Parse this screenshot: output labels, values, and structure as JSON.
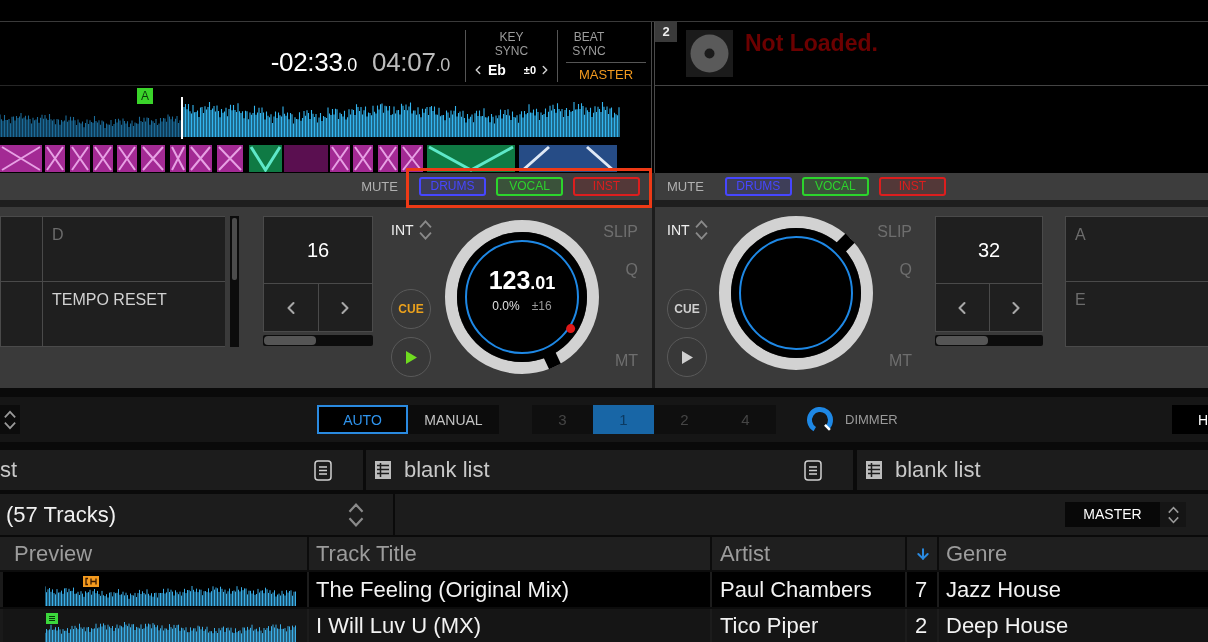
{
  "decks": [
    {
      "loaded": true,
      "remaining_time": {
        "value": "-02:33",
        "fraction": ".0"
      },
      "total_time": {
        "value": "04:07",
        "fraction": ".0"
      },
      "key_sync": {
        "label": "KEY SYNC",
        "key": "Eb",
        "offset": "±0"
      },
      "beat_sync": {
        "label": "BEAT SYNC",
        "master": "MASTER"
      },
      "memory_cue": "A",
      "mute": {
        "label": "MUTE",
        "highlighted": true,
        "buttons": [
          {
            "label": "DRUMS",
            "color": "#4646ff"
          },
          {
            "label": "VOCAL",
            "color": "#2cd42c"
          },
          {
            "label": "INST",
            "color": "#dc1e1e"
          }
        ]
      },
      "pads": [
        {
          "label": "D",
          "assigned": false
        },
        {
          "label": "TEMPO RESET",
          "assigned": true
        }
      ],
      "beat_loop": "16",
      "int_label": "INT",
      "cue": {
        "label": "CUE",
        "lit": true
      },
      "play": {
        "on": true
      },
      "jog": {
        "bpm": "123",
        "bpm_fraction": ".01",
        "pitch": "0.0%",
        "range": "±16",
        "cue_marker": true
      },
      "modes": [
        "SLIP",
        "Q",
        "MT"
      ]
    },
    {
      "loaded": false,
      "badge": "2",
      "status": "Not Loaded.",
      "mute": {
        "label": "MUTE",
        "buttons": [
          {
            "label": "DRUMS",
            "color": "#4646ff"
          },
          {
            "label": "VOCAL",
            "color": "#2cd42c"
          },
          {
            "label": "INST",
            "color": "#dc1e1e"
          }
        ]
      },
      "pads": [
        {
          "label": "A",
          "assigned": false
        },
        {
          "label": "E",
          "assigned": false
        }
      ],
      "beat_loop": "32",
      "int_label": "INT",
      "cue": {
        "label": "CUE",
        "lit": false
      },
      "play": {
        "on": false
      },
      "modes": [
        "SLIP",
        "Q",
        "MT"
      ]
    }
  ],
  "mixer_bar": {
    "sync_modes": [
      {
        "label": "AUTO",
        "selected": true
      },
      {
        "label": "MANUAL",
        "selected": false
      }
    ],
    "deck_order": [
      {
        "label": "3",
        "selected": false
      },
      {
        "label": "1",
        "selected": true
      },
      {
        "label": "2",
        "selected": false
      },
      {
        "label": "4",
        "selected": false
      }
    ],
    "dimmer": {
      "label": "DIMMER"
    },
    "right_button": "H"
  },
  "browser": {
    "panels": [
      {
        "title": "st"
      },
      {
        "title": "blank list"
      },
      {
        "title": "blank list"
      }
    ],
    "track_count": "(57 Tracks)",
    "master_select": "MASTER",
    "table": {
      "columns": [
        {
          "label": "Preview",
          "sorted": false
        },
        {
          "label": "Track Title",
          "sorted": false
        },
        {
          "label": "Artist",
          "sorted": false
        },
        {
          "sorted": true
        },
        {
          "label": "Genre",
          "sorted": false
        }
      ],
      "rows": [
        {
          "preview_marker": {
            "kind": "bracket",
            "color": "#f39a1e"
          },
          "track_title": "The Feeling (Original Mix)",
          "artist": "Paul Chambers",
          "column_4": "7",
          "genre": "Jazz House"
        },
        {
          "preview_marker": {
            "kind": "lines",
            "color": "#3cd83c"
          },
          "track_title": "I Will Luv U (MX)",
          "artist": "Tico Piper",
          "column_4": "2",
          "genre": "Deep House"
        }
      ]
    }
  }
}
